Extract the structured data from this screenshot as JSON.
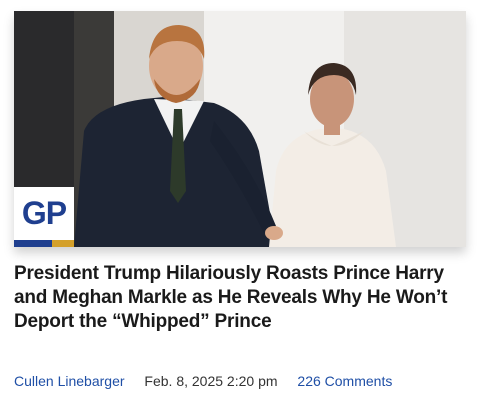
{
  "article": {
    "headline": "President Trump Hilariously Roasts Prince Harry and Meghan Markle as He Reveals Why He Won’t Deport the “Whipped” Prince",
    "author": "Cullen Linebarger",
    "date": "Feb. 8, 2025 2:20 pm",
    "comments": "226 Comments",
    "image_badge": "GP"
  },
  "colors": {
    "brand_blue": "#1f3f8f",
    "link_blue": "#1f4fa6",
    "badge_gold": "#d4a02a"
  }
}
